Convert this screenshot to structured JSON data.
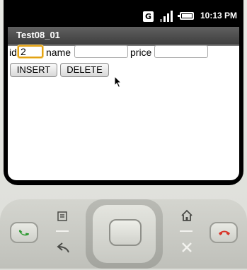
{
  "status_bar": {
    "network_badge": "G",
    "signal_icon": "signal-bars-icon",
    "battery_icon": "battery-icon",
    "time": "10:13 PM"
  },
  "app": {
    "title": "Test08_01"
  },
  "form": {
    "id_label": "id",
    "id_value": "2",
    "name_label": "name",
    "name_value": "",
    "price_label": "price",
    "price_value": ""
  },
  "buttons": {
    "insert_label": "INSERT",
    "delete_label": "DELETE"
  },
  "hardware": {
    "call_icon": "call-icon",
    "menu_icon": "menu-icon",
    "back_icon": "back-icon",
    "home_icon": "home-icon",
    "search_icon": "search-icon",
    "end_call_icon": "end-call-icon"
  },
  "colors": {
    "focus_border": "#e2a114",
    "call_green": "#2e9a32",
    "end_call_red": "#d8352a"
  }
}
